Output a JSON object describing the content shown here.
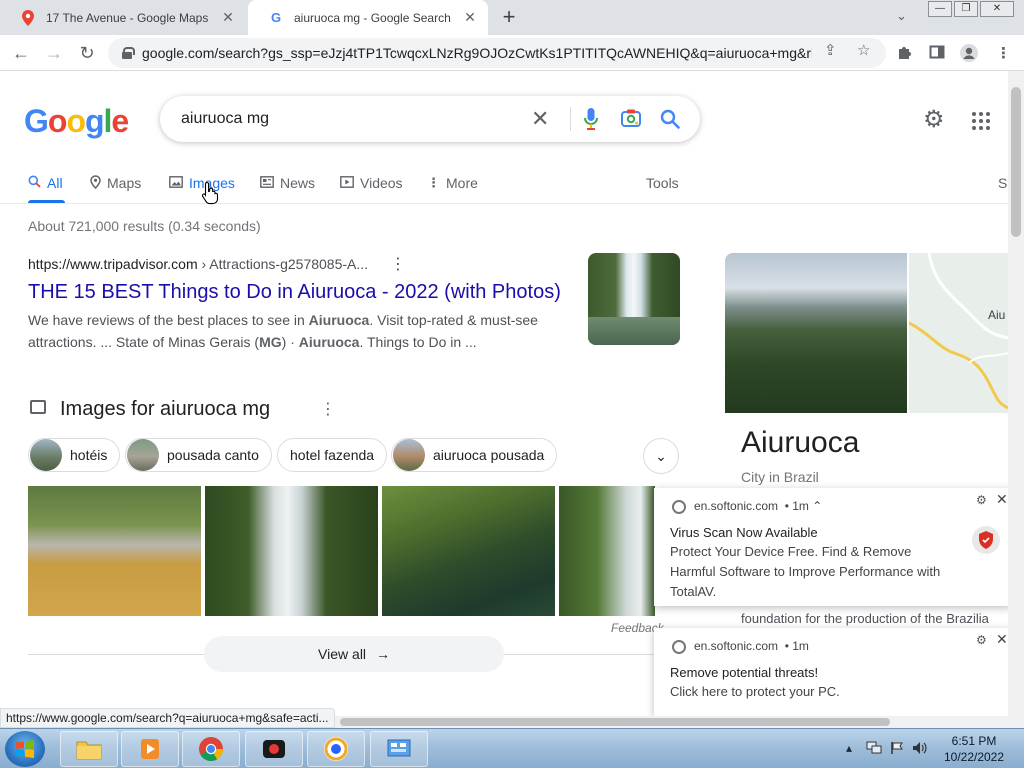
{
  "browser": {
    "tabs": [
      {
        "title": "17 The Avenue - Google Maps",
        "active": false,
        "icon": "google-maps-favicon"
      },
      {
        "title": "aiuruoca mg - Google Search",
        "active": true,
        "icon": "google-favicon"
      }
    ],
    "address": "google.com/search?gs_ssp=eJzj4tTP1TcwqcxLNzRg9OJOzCwtKs1PTITITQcAWNEHIQ&q=aiuruoca+mg&rlz...",
    "status_url": "https://www.google.com/search?q=aiuruoca+mg&safe=acti..."
  },
  "search": {
    "query": "aiuruoca mg",
    "logo": [
      "G",
      "o",
      "o",
      "g",
      "l",
      "e"
    ]
  },
  "nav": {
    "tabs": [
      {
        "label": "All",
        "icon": "search-icon",
        "active": true
      },
      {
        "label": "Maps",
        "icon": "map-pin-icon",
        "active": false
      },
      {
        "label": "Images",
        "icon": "image-icon",
        "active": false
      },
      {
        "label": "News",
        "icon": "news-icon",
        "active": false
      },
      {
        "label": "Videos",
        "icon": "video-icon",
        "active": false
      },
      {
        "label": "More",
        "icon": "more-vertical-icon",
        "active": false
      }
    ],
    "tools": "Tools",
    "edge_text": "S"
  },
  "results": {
    "stats": "About 721,000 results (0.34 seconds)",
    "items": [
      {
        "cite_host": "https://www.tripadvisor.com",
        "cite_path": " › Attractions-g2578085-A...",
        "title": "THE 15 BEST Things to Do in Aiuruoca - 2022 (with Photos)",
        "snippet": [
          {
            "t": "We have reviews of the best places to see in ",
            "b": false
          },
          {
            "t": "Aiuruoca",
            "b": true
          },
          {
            "t": ". Visit top-rated & must-see attractions. ... State of Minas Gerais (",
            "b": false
          },
          {
            "t": "MG",
            "b": true
          },
          {
            "t": ") · ",
            "b": false
          },
          {
            "t": "Aiuruoca",
            "b": true
          },
          {
            "t": ". Things to Do in ...",
            "b": false
          }
        ]
      }
    ]
  },
  "images_section": {
    "heading": "Images for aiuruoca mg",
    "chips": [
      {
        "label": "hotéis",
        "has_image": true
      },
      {
        "label": "pousada canto",
        "has_image": true
      },
      {
        "label": "hotel fazenda",
        "has_image": false
      },
      {
        "label": "aiuruoca pousada",
        "has_image": true
      }
    ],
    "feedback": "Feedback",
    "view_all": "View all"
  },
  "knowledge_panel": {
    "title": "Aiuruoca",
    "subtitle": "City in Brazil",
    "map_label": "Aiu",
    "snippet_partial": "foundation for the production of the Brazilia"
  },
  "notifications": [
    {
      "source": "en.softonic.com",
      "age": "• 1m",
      "title": "Virus Scan Now Available",
      "body": "Protect Your Device Free. Find & Remove Harmful Software to Improve Performance with TotalAV."
    },
    {
      "source": "en.softonic.com",
      "age": "• 1m",
      "title": "Remove potential threats!",
      "body": "Click here to protect your PC."
    }
  ],
  "taskbar": {
    "time": "6:51 PM",
    "date": "10/22/2022"
  },
  "colors": {
    "link": "#1a0dab",
    "accent": "#1a73e8",
    "taskbar": "#9dbcd9"
  }
}
